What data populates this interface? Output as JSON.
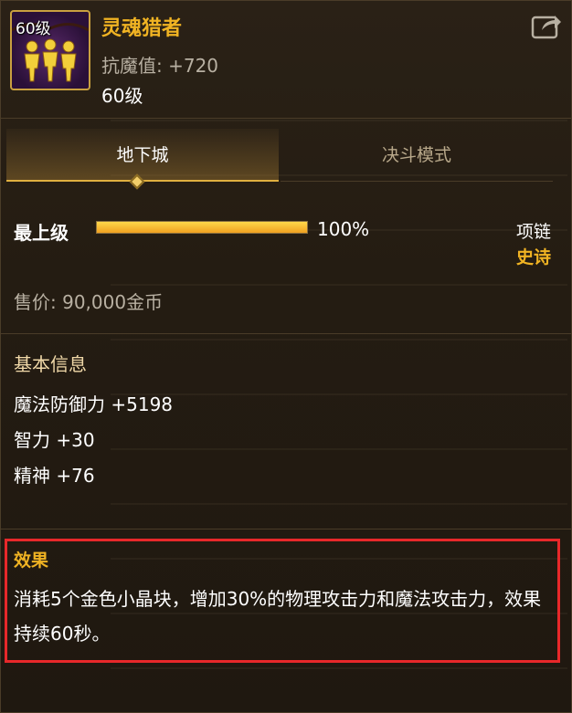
{
  "item": {
    "name": "灵魂猎者",
    "icon_level": "60级",
    "magic_resist": "抗魔值: +720",
    "level": "60级",
    "icon": "soul-hunter-icon"
  },
  "tabs": [
    {
      "label": "地下城",
      "active": true
    },
    {
      "label": "决斗模式",
      "active": false
    }
  ],
  "progress": {
    "label": "最上级",
    "value": 1.0,
    "percent_text": "100%"
  },
  "slot": {
    "type": "项链",
    "rarity": "史诗"
  },
  "price": "售价: 90,000金币",
  "basic_info": {
    "title": "基本信息",
    "attributes": [
      "魔法防御力 +5198",
      "智力 +30",
      "精神 +76"
    ]
  },
  "effect": {
    "title": "效果",
    "description": "消耗5个金色小晶块，增加30%的物理攻击力和魔法攻击力，效果持续60秒。"
  },
  "colors": {
    "accent_gold": "#f0b323",
    "highlight_red": "#e8282a",
    "progress_fill": "#ffd84a"
  }
}
